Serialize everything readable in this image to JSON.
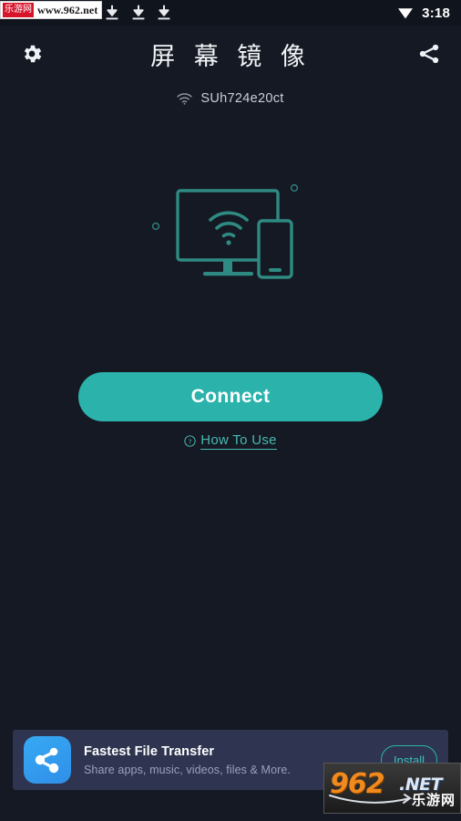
{
  "colors": {
    "background": "#141923",
    "accent_teal": "#2ab2ab",
    "accent_teal_light": "#49b9b2",
    "app_bar_text": "#f2f4f7",
    "ad_background": "#2f3550",
    "ad_icon_blue": "#37a9f4",
    "watermark_orange": "#f08a1e",
    "watermark_red": "#d6142a"
  },
  "watermark_top": {
    "badge": "乐游网",
    "url": "www.962.net",
    "download_icons": [
      "download-icon",
      "download-icon",
      "download-icon"
    ]
  },
  "status_bar": {
    "wifi_icon": "wifi-icon",
    "time": "3:18"
  },
  "app_bar": {
    "settings_icon": "gear-icon",
    "title": "屏 幕 镜 像",
    "share_icon": "share-icon"
  },
  "device": {
    "wifi_icon": "wifi-icon",
    "name": "SUh724e20ct"
  },
  "illustration": {
    "name": "screen-mirroring-illustration",
    "elements": [
      "tv-monitor",
      "wifi-signal",
      "smartphone",
      "decor-circle-left",
      "decor-circle-right"
    ]
  },
  "actions": {
    "connect_label": "Connect",
    "how_to_use_label": "How To Use",
    "how_to_use_icon": "question-circle-icon"
  },
  "ad": {
    "app_icon": "share-network-icon",
    "title": "Fastest File Transfer",
    "subtitle": "Share apps, music, videos, files & More.",
    "install_label": "Install"
  },
  "watermark_bottom": {
    "number": "962",
    "tld": ".NET",
    "cn": "乐游网"
  }
}
